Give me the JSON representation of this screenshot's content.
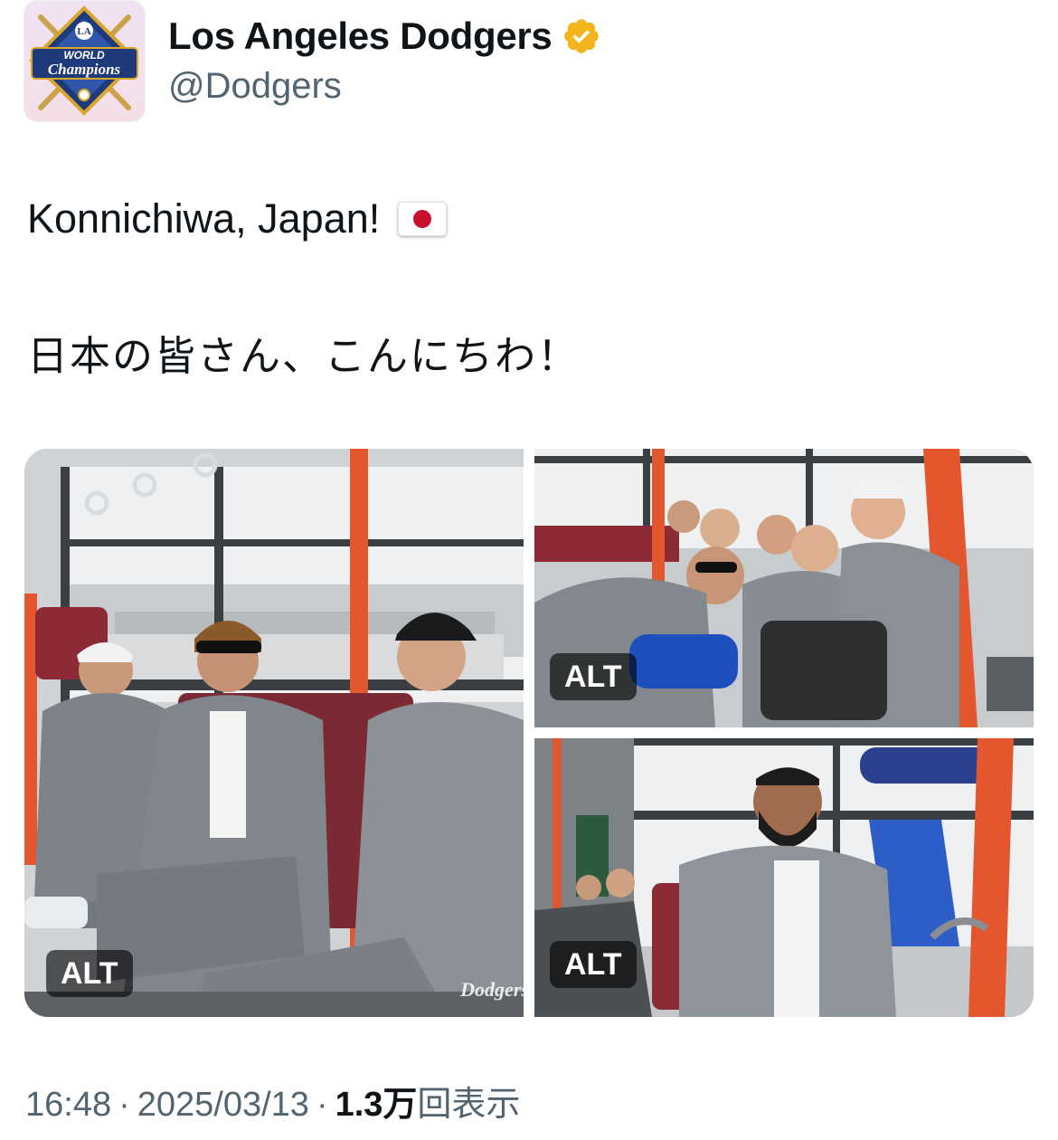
{
  "account": {
    "display_name": "Los Angeles Dodgers",
    "handle": "@Dodgers",
    "verified_badge": "gold-verified-icon",
    "avatar_text": {
      "top": "WORLD",
      "bottom": "Champions",
      "logo": "LA"
    },
    "colors": {
      "avatar_navy": "#1e3a7b",
      "avatar_gold": "#d9a62a",
      "badge_gold": "#f2b51d"
    }
  },
  "tweet": {
    "line_1": "Konnichiwa, Japan!",
    "line_1_emoji": "japan-flag-icon",
    "line_2": "日本の皆さん、こんにちわ！"
  },
  "media": [
    {
      "alt_label": "ALT",
      "watermark": "Dodgers"
    },
    {
      "alt_label": "ALT"
    },
    {
      "alt_label": "ALT"
    }
  ],
  "meta": {
    "time": "16:48",
    "separator": "·",
    "date": "2025/03/13",
    "views_count": "1.3万",
    "views_label": "回表示"
  }
}
